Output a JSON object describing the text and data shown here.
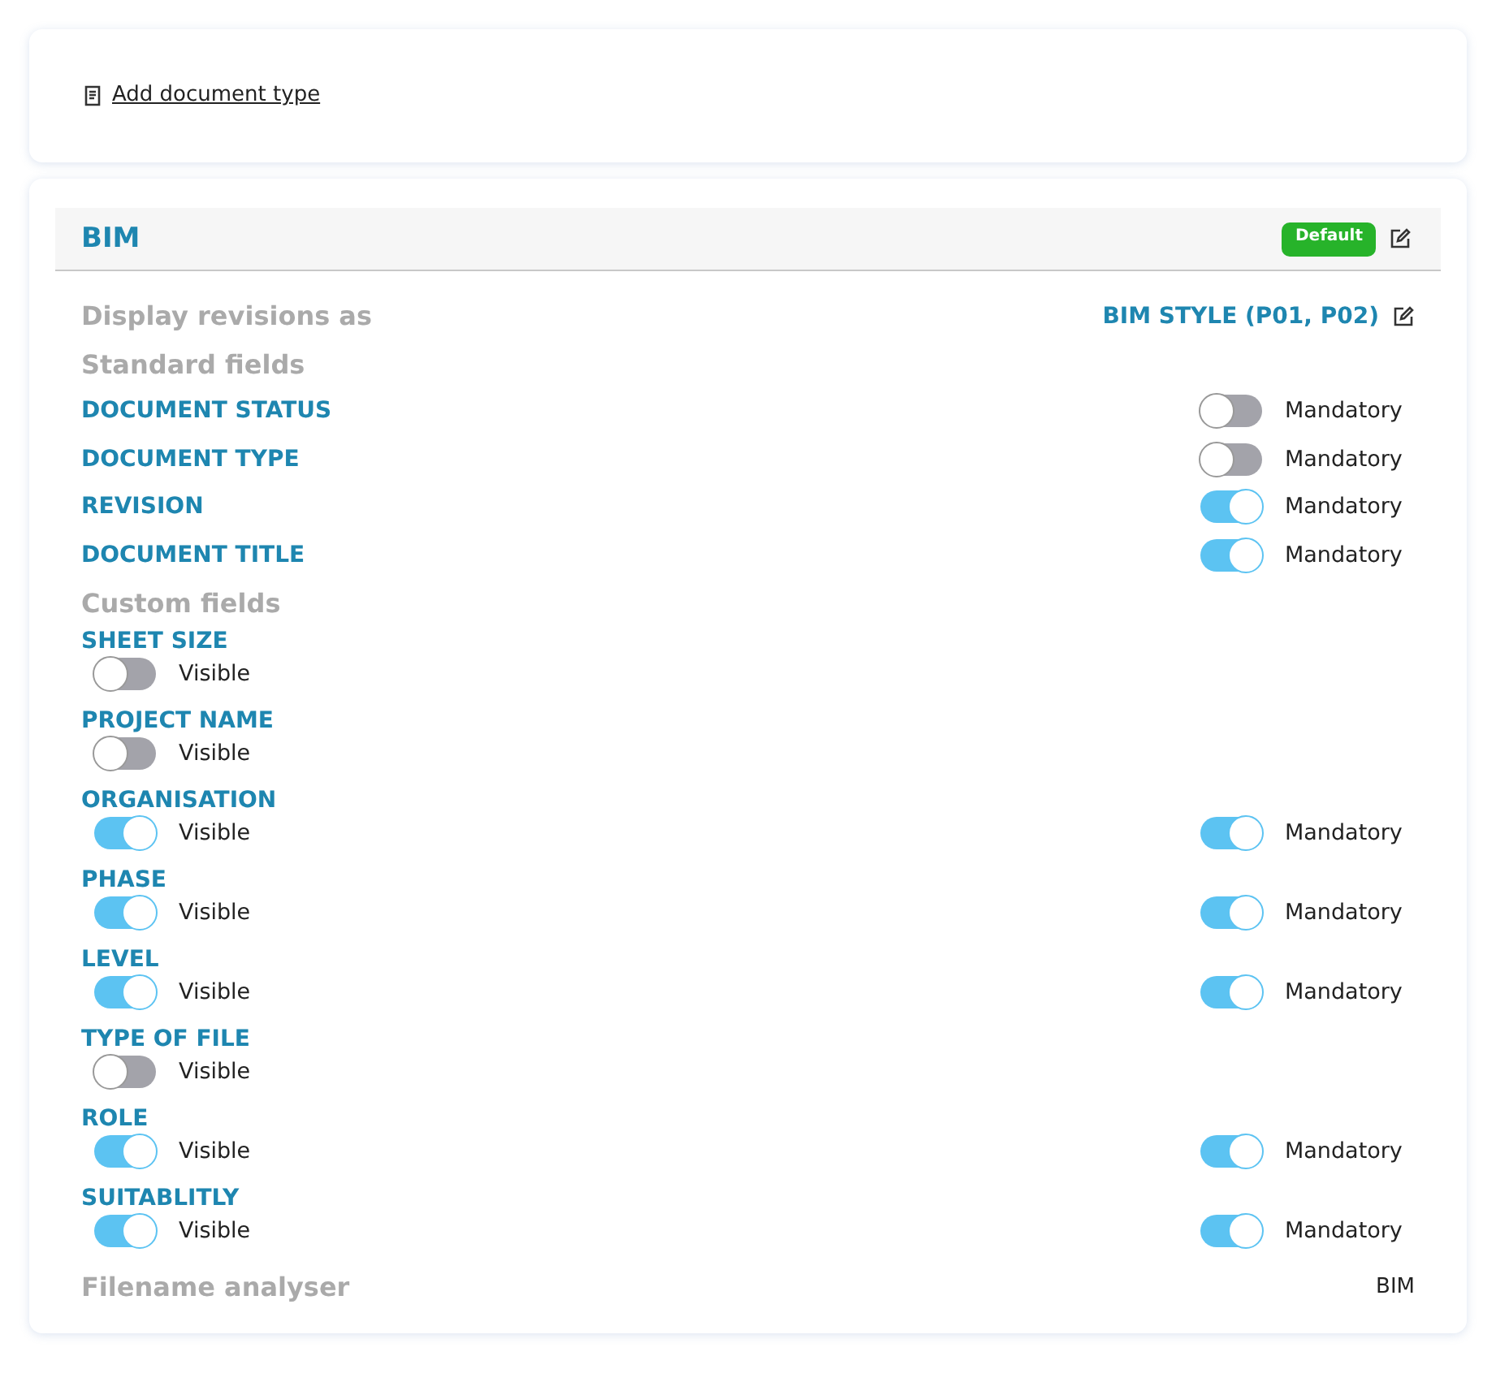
{
  "add_link": {
    "label": "Add document type"
  },
  "doc_type": {
    "title": "BIM",
    "badge": "Default",
    "display_revisions": {
      "label": "Display revisions as",
      "value": "BIM STYLE (P01, P02)"
    },
    "standard_heading": "Standard fields",
    "standard_fields": [
      {
        "label": "DOCUMENT STATUS",
        "mandatory": {
          "on": false,
          "label": "Mandatory"
        }
      },
      {
        "label": "DOCUMENT TYPE",
        "mandatory": {
          "on": false,
          "label": "Mandatory"
        }
      },
      {
        "label": "REVISION",
        "mandatory": {
          "on": true,
          "label": "Mandatory"
        }
      },
      {
        "label": "DOCUMENT TITLE",
        "mandatory": {
          "on": true,
          "label": "Mandatory"
        }
      }
    ],
    "custom_heading": "Custom fields",
    "custom_fields": [
      {
        "label": "SHEET SIZE",
        "visible": {
          "on": false,
          "label": "Visible"
        }
      },
      {
        "label": "PROJECT NAME",
        "visible": {
          "on": false,
          "label": "Visible"
        }
      },
      {
        "label": "ORGANISATION",
        "visible": {
          "on": true,
          "label": "Visible"
        },
        "mandatory": {
          "on": true,
          "label": "Mandatory"
        }
      },
      {
        "label": "PHASE",
        "visible": {
          "on": true,
          "label": "Visible"
        },
        "mandatory": {
          "on": true,
          "label": "Mandatory"
        }
      },
      {
        "label": "LEVEL",
        "visible": {
          "on": true,
          "label": "Visible"
        },
        "mandatory": {
          "on": true,
          "label": "Mandatory"
        }
      },
      {
        "label": "TYPE OF FILE",
        "visible": {
          "on": false,
          "label": "Visible"
        }
      },
      {
        "label": "ROLE",
        "visible": {
          "on": true,
          "label": "Visible"
        },
        "mandatory": {
          "on": true,
          "label": "Mandatory"
        }
      },
      {
        "label": "SUITABLITLY",
        "visible": {
          "on": true,
          "label": "Visible"
        },
        "mandatory": {
          "on": true,
          "label": "Mandatory"
        }
      }
    ],
    "filename_analyser": {
      "label": "Filename analyser",
      "value": "BIM"
    }
  }
}
